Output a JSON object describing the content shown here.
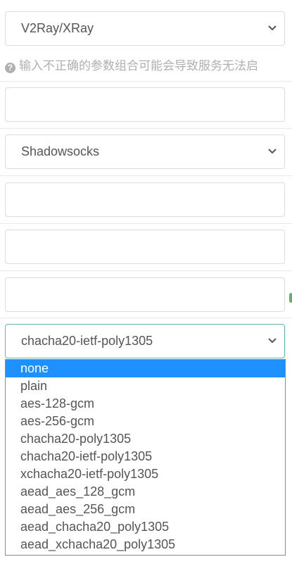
{
  "form": {
    "client_select": {
      "value": "V2Ray/XRay"
    },
    "hint": {
      "icon": "question-circle-icon",
      "text": "输入不正确的参数组合可能会导致服务无法启"
    },
    "text_field_1": {
      "value": ""
    },
    "protocol_select": {
      "value": "Shadowsocks"
    },
    "text_field_2": {
      "value": ""
    },
    "text_field_3": {
      "value": ""
    },
    "text_field_4": {
      "value": ""
    },
    "encryption_select": {
      "value": "chacha20-ietf-poly1305"
    }
  },
  "dropdown": {
    "selected_index": 0,
    "options": [
      "none",
      "plain",
      "aes-128-gcm",
      "aes-256-gcm",
      "chacha20-poly1305",
      "chacha20-ietf-poly1305",
      "xchacha20-ietf-poly1305",
      "aead_aes_128_gcm",
      "aead_aes_256_gcm",
      "aead_chacha20_poly1305",
      "aead_xchacha20_poly1305"
    ]
  },
  "colors": {
    "highlight": "#1e90ff",
    "focus_border": "#5fb8b8",
    "status_mark": "#59b85b"
  }
}
